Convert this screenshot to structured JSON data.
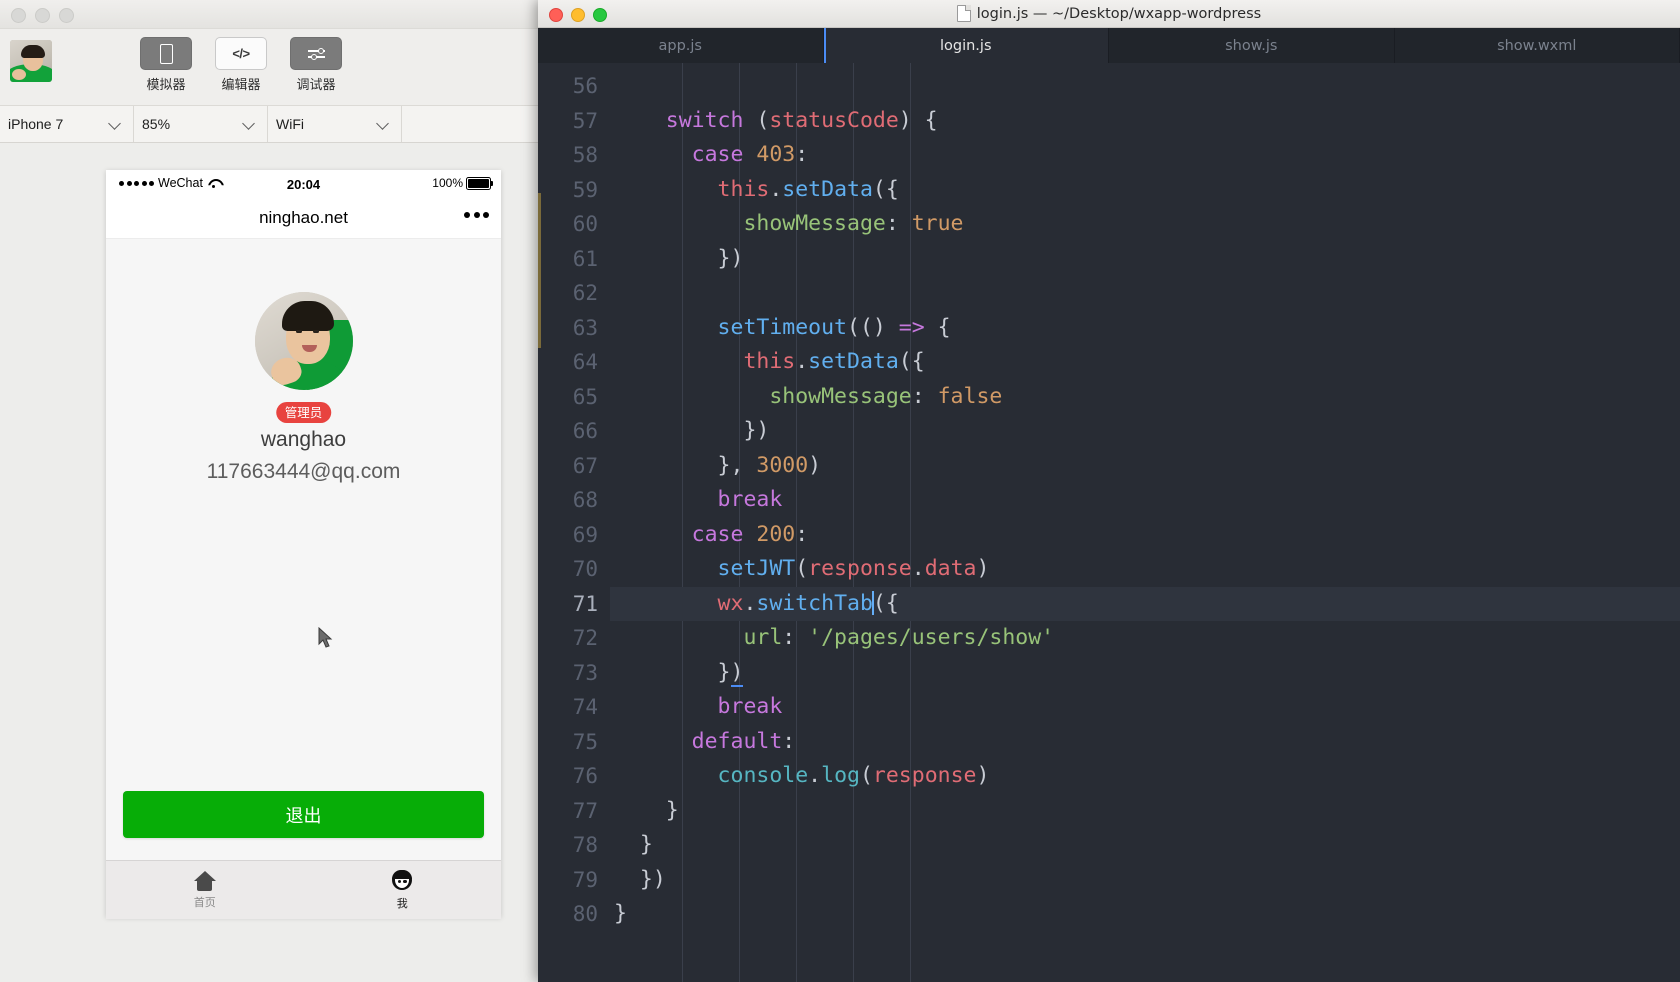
{
  "devtools": {
    "window_controls": [
      "minimize",
      "minimize",
      "minimize"
    ],
    "toolbar_buttons": [
      {
        "label": "模拟器",
        "icon": "phone-icon",
        "state": "active"
      },
      {
        "label": "编辑器",
        "icon": "code-icon",
        "state": "selected"
      },
      {
        "label": "调试器",
        "icon": "sliders-icon",
        "state": "active"
      }
    ],
    "selects": [
      {
        "name": "device",
        "value": "iPhone 7"
      },
      {
        "name": "zoom",
        "value": "85%"
      },
      {
        "name": "network",
        "value": "WiFi"
      }
    ]
  },
  "simulator": {
    "status_bar": {
      "carrier": "WeChat",
      "time": "20:04",
      "battery": "100%"
    },
    "nav_title": "ninghao.net",
    "profile": {
      "role_badge": "管理员",
      "username": "wanghao",
      "email": "117663444@qq.com"
    },
    "logout_button": "退出",
    "logout_color": "#07ad07",
    "badge_color": "#e8433f",
    "tabbar": [
      {
        "label": "首页",
        "icon": "home-icon",
        "active": false
      },
      {
        "label": "我",
        "icon": "person-icon",
        "active": true
      }
    ]
  },
  "editor": {
    "window_title": "login.js — ~/Desktop/wxapp-wordpress",
    "traffic_lights": [
      "close",
      "minimize",
      "zoom"
    ],
    "tabs": [
      {
        "label": "app.js",
        "active": false
      },
      {
        "label": "login.js",
        "active": true
      },
      {
        "label": "show.js",
        "active": false
      },
      {
        "label": "show.wxml",
        "active": false
      }
    ],
    "active_tab_accent": "#4b8cf5",
    "cursor_line": 71,
    "background": "#282c34",
    "line_numbers": [
      56,
      57,
      58,
      59,
      60,
      61,
      62,
      63,
      64,
      65,
      66,
      67,
      68,
      69,
      70,
      71,
      72,
      73,
      74,
      75,
      76,
      77,
      78,
      79,
      80
    ],
    "lines": [
      {
        "n": 56,
        "text": ""
      },
      {
        "n": 57,
        "text": "    switch (statusCode) {"
      },
      {
        "n": 58,
        "text": "      case 403:"
      },
      {
        "n": 59,
        "text": "        this.setData({"
      },
      {
        "n": 60,
        "text": "          showMessage: true"
      },
      {
        "n": 61,
        "text": "        })"
      },
      {
        "n": 62,
        "text": ""
      },
      {
        "n": 63,
        "text": "        setTimeout(() => {"
      },
      {
        "n": 64,
        "text": "          this.setData({"
      },
      {
        "n": 65,
        "text": "            showMessage: false"
      },
      {
        "n": 66,
        "text": "          })"
      },
      {
        "n": 67,
        "text": "        }, 3000)"
      },
      {
        "n": 68,
        "text": "        break"
      },
      {
        "n": 69,
        "text": "      case 200:"
      },
      {
        "n": 70,
        "text": "        setJWT(response.data)"
      },
      {
        "n": 71,
        "text": "        wx.switchTab({"
      },
      {
        "n": 72,
        "text": "          url: '/pages/users/show'"
      },
      {
        "n": 73,
        "text": "        })"
      },
      {
        "n": 74,
        "text": "        break"
      },
      {
        "n": 75,
        "text": "      default:"
      },
      {
        "n": 76,
        "text": "        console.log(response)"
      },
      {
        "n": 77,
        "text": "    }"
      },
      {
        "n": 78,
        "text": "  }"
      },
      {
        "n": 79,
        "text": "  })"
      },
      {
        "n": 80,
        "text": "}"
      }
    ],
    "token_colors": {
      "keyword": "#c678dd",
      "function": "#61afef",
      "variable": "#e06c75",
      "number": "#d19a66",
      "string": "#98c379",
      "property": "#98c379",
      "punctuation": "#c8ccd4",
      "console": "#56b6c2"
    }
  }
}
